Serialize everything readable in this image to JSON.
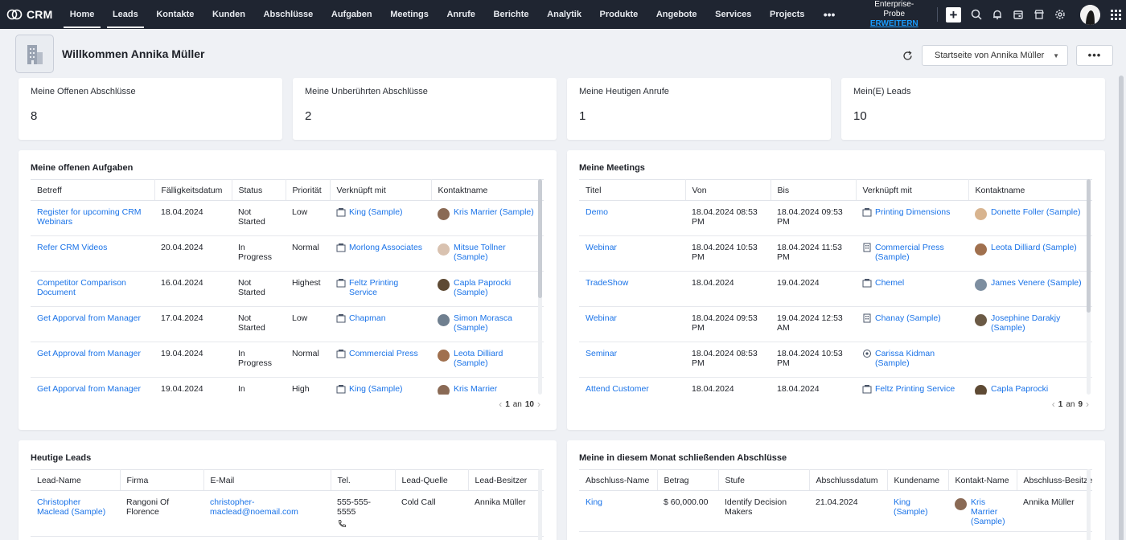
{
  "app": {
    "name": "CRM"
  },
  "nav": {
    "items": [
      "Home",
      "Leads",
      "Kontakte",
      "Kunden",
      "Abschlüsse",
      "Aufgaben",
      "Meetings",
      "Anrufe",
      "Berichte",
      "Analytik",
      "Produkte",
      "Angebote",
      "Services",
      "Projects"
    ],
    "more": "•••"
  },
  "trial": {
    "edition": "Enterprise-Probe",
    "upgrade": "ERWEITERN"
  },
  "header": {
    "welcome": "Willkommen Annika Müller",
    "view_select": "Startseite von Annika Müller",
    "more": "•••"
  },
  "stats": [
    {
      "label": "Meine Offenen Abschlüsse",
      "value": "8"
    },
    {
      "label": "Meine Unberührten Abschlüsse",
      "value": "2"
    },
    {
      "label": "Meine Heutigen Anrufe",
      "value": "1"
    },
    {
      "label": "Mein(E) Leads",
      "value": "10"
    }
  ],
  "tasks": {
    "title": "Meine offenen Aufgaben",
    "columns": [
      "Betreff",
      "Fälligkeitsdatum",
      "Status",
      "Priorität",
      "Verknüpft mit",
      "Kontaktname"
    ],
    "rows": [
      {
        "subject": "Register for upcoming CRM Webinars",
        "due": "18.04.2024",
        "status": "Not Started",
        "priority": "Low",
        "related": "King (Sample)",
        "contact": "Kris Marrier (Sample)"
      },
      {
        "subject": "Refer CRM Videos",
        "due": "20.04.2024",
        "status": "In Progress",
        "priority": "Normal",
        "related": "Morlong Associates",
        "contact": "Mitsue Tollner (Sample)"
      },
      {
        "subject": "Competitor Comparison Document",
        "due": "16.04.2024",
        "status": "Not Started",
        "priority": "Highest",
        "related": "Feltz Printing Service",
        "contact": "Capla Paprocki (Sample)"
      },
      {
        "subject": "Get Apporval from Manager",
        "due": "17.04.2024",
        "status": "Not Started",
        "priority": "Low",
        "related": "Chapman",
        "contact": "Simon Morasca (Sample)"
      },
      {
        "subject": "Get Approval from Manager",
        "due": "19.04.2024",
        "status": "In Progress",
        "priority": "Normal",
        "related": "Commercial Press",
        "contact": "Leota Dilliard (Sample)"
      },
      {
        "subject": "Get Apporval from Manager",
        "due": "19.04.2024",
        "status": "In",
        "priority": "High",
        "related": "King (Sample)",
        "contact": "Kris Marrier"
      }
    ],
    "pager": {
      "current": "1",
      "sep": "an",
      "total": "10"
    }
  },
  "meetings": {
    "title": "Meine Meetings",
    "columns": [
      "Titel",
      "Von",
      "Bis",
      "Verknüpft mit",
      "Kontaktname"
    ],
    "rows": [
      {
        "title": "Demo",
        "from": "18.04.2024 08:53 PM",
        "to": "18.04.2024 09:53 PM",
        "related": "Printing Dimensions",
        "contact": "Donette Foller (Sample)"
      },
      {
        "title": "Webinar",
        "from": "18.04.2024 10:53 PM",
        "to": "18.04.2024 11:53 PM",
        "related": "Commercial Press (Sample)",
        "contact": "Leota Dilliard (Sample)"
      },
      {
        "title": "TradeShow",
        "from": "18.04.2024",
        "to": "19.04.2024",
        "related": "Chemel",
        "contact": "James Venere (Sample)"
      },
      {
        "title": "Webinar",
        "from": "18.04.2024 09:53 PM",
        "to": "19.04.2024 12:53 AM",
        "related": "Chanay (Sample)",
        "contact": "Josephine Darakjy (Sample)"
      },
      {
        "title": "Seminar",
        "from": "18.04.2024 08:53 PM",
        "to": "18.04.2024 10:53 PM",
        "related": "Carissa Kidman (Sample)",
        "contact": ""
      },
      {
        "title": "Attend Customer",
        "from": "18.04.2024",
        "to": "18.04.2024",
        "related": "Feltz Printing Service",
        "contact": "Capla Paprocki"
      }
    ],
    "pager": {
      "current": "1",
      "sep": "an",
      "total": "9"
    }
  },
  "leads": {
    "title": "Heutige Leads",
    "columns": [
      "Lead-Name",
      "Firma",
      "E-Mail",
      "Tel.",
      "Lead-Quelle",
      "Lead-Besitzer"
    ],
    "rows": [
      {
        "name": "Christopher Maclead (Sample)",
        "company": "Rangoni Of Florence",
        "email": "christopher-maclead@noemail.com",
        "phone": "555-555-5555",
        "source": "Cold Call",
        "owner": "Annika Müller"
      }
    ]
  },
  "deals": {
    "title": "Meine in diesem Monat schließenden Abschlüsse",
    "columns": [
      "Abschluss-Name",
      "Betrag",
      "Stufe",
      "Abschlussdatum",
      "Kundename",
      "Kontakt-Name",
      "Abschluss-Besitzer"
    ],
    "rows": [
      {
        "name": "King",
        "amount": "$ 60,000.00",
        "stage": "Identify Decision Makers",
        "date": "21.04.2024",
        "account": "King (Sample)",
        "contact": "Kris Marrier (Sample)",
        "owner": "Annika Müller"
      }
    ]
  },
  "colors": {
    "topbar": "#1f2531",
    "link": "#1a73e8",
    "upgrade": "#1a9dff"
  }
}
